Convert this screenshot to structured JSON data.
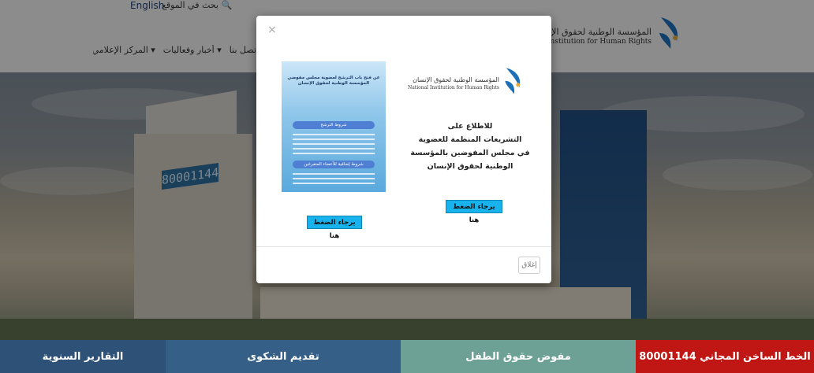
{
  "header": {
    "language_link": "English",
    "search_label": "بحث",
    "search_text": "بحث في الموقع",
    "nav_items": [
      "اتصل بنا",
      "أخبار وفعاليات ▾",
      "المركز الإعلامي ▾"
    ],
    "org_name_ar": "المؤسسة الوطنية لحقوق الإنسان",
    "org_name_en": "National Institution for Human Rights"
  },
  "hero": {
    "sign_number": "80001144"
  },
  "bottom_bar": {
    "items": [
      "الخط الساخن المجاني 80001144",
      "مفوض حقوق الطفل",
      "تقديم الشكوى",
      "التقارير السنوية"
    ]
  },
  "modal": {
    "close_x": "×",
    "logo_ar": "المؤسسة الوطنية لحقوق الإنسان",
    "logo_en": "National Institution for Human Rights",
    "info_lines": [
      "للاطلاع على",
      "التشريعات المنظمة للعضوية",
      "في مجلس المفوضين بالمؤسسة",
      "الوطنية لحقوق الإنسان"
    ],
    "cta_right": "يرجاء الضغط هنا",
    "cta_left": "يرجاء الضغط هنا",
    "close_button": "إغلاق",
    "poster": {
      "heading": "عن فتح باب الترشح لعضوية مجلس مفوضي المؤسسة الوطنية لحقوق الإنسان",
      "band1": "شروط الترشح",
      "band2": "شروط إضافية للأعضاء المتفرغين"
    }
  },
  "colors": {
    "hotline_red": "#c01614",
    "child_rights_teal": "#6ea196",
    "complaint_blue": "#355f86",
    "reports_blue": "#2e5177",
    "cta_blue": "#18b2ec"
  }
}
